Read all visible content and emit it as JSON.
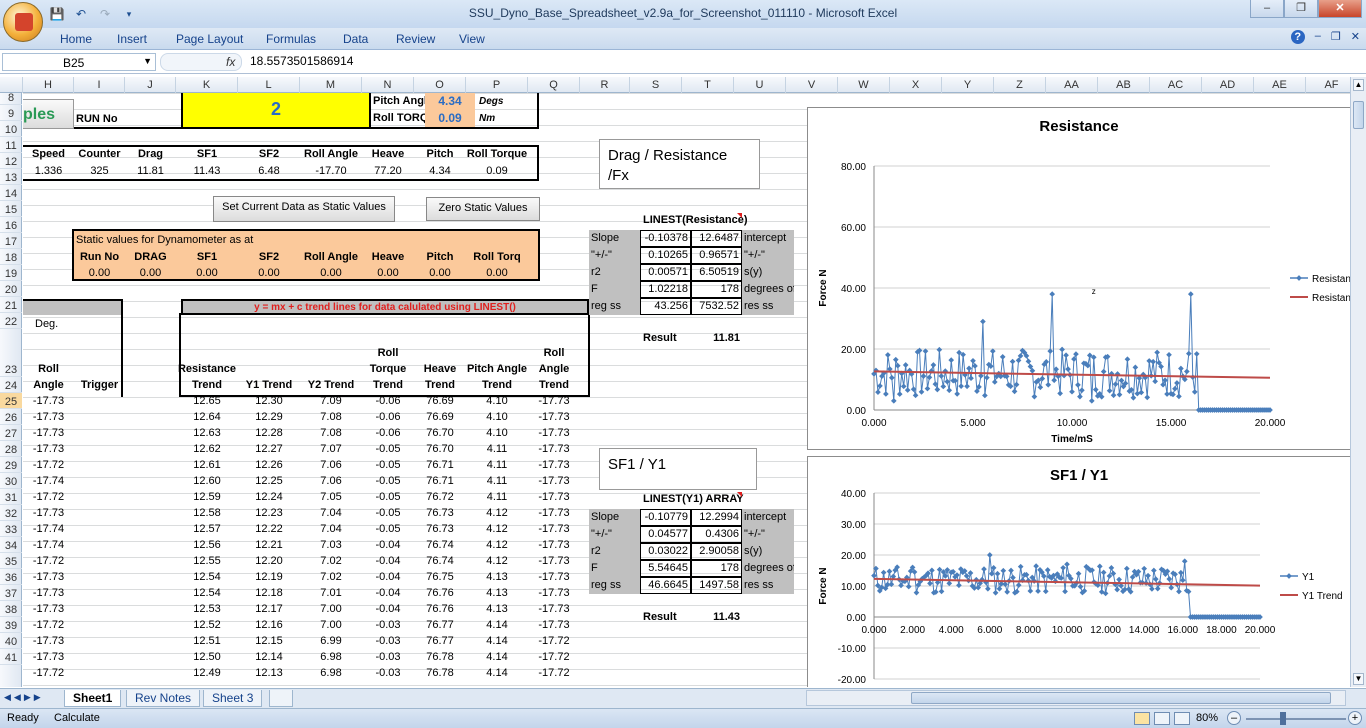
{
  "window": {
    "title": "SSU_Dyno_Base_Spreadsheet_v2.9a_for_Screenshot_011110 - Microsoft Excel"
  },
  "ribbon": {
    "tabs": [
      "Home",
      "Insert",
      "Page Layout",
      "Formulas",
      "Data",
      "Review",
      "View"
    ]
  },
  "formula_bar": {
    "name_box": "B25",
    "fx": "fx",
    "value": "18.5573501586914"
  },
  "columns": [
    "H",
    "I",
    "J",
    "K",
    "L",
    "M",
    "N",
    "O",
    "P",
    "Q",
    "R",
    "S",
    "T",
    "U",
    "V",
    "W",
    "X",
    "Y",
    "Z",
    "AA",
    "AB",
    "AC",
    "AD",
    "AE",
    "AF"
  ],
  "rows": [
    "8",
    "9",
    "10",
    "11",
    "12",
    "13",
    "14",
    "15",
    "16",
    "17",
    "18",
    "19",
    "20",
    "21",
    "22",
    "23",
    "24",
    "25",
    "26",
    "27",
    "28",
    "29",
    "30",
    "31",
    "32",
    "33",
    "34",
    "35",
    "36",
    "37",
    "38",
    "39",
    "40",
    "41"
  ],
  "header_block": {
    "ples": "ples",
    "run_no_label": "RUN No",
    "run_no_value": "2",
    "pitch_angle_label": "Pitch Angl",
    "pitch_angle_value": "4.34",
    "pitch_unit": "Degs",
    "roll_torque_label": "Roll TORQ",
    "roll_torque_value": "0.09",
    "roll_unit": "Nm"
  },
  "live_table": {
    "headers": [
      "Speed",
      "Counter",
      "Drag",
      "SF1",
      "SF2",
      "Roll Angle",
      "Heave",
      "Pitch",
      "Roll Torque"
    ],
    "values": [
      "1.336",
      "325",
      "11.81",
      "11.43",
      "6.48",
      "-17.70",
      "77.20",
      "4.34",
      "0.09"
    ]
  },
  "buttons": {
    "set_static": "Set Current Data as Static Values",
    "zero_static": "Zero Static Values"
  },
  "static_table": {
    "title": "Static values for Dynamometer as at",
    "headers": [
      "Run No",
      "DRAG",
      "SF1",
      "SF2",
      "Roll Angle",
      "Heave",
      "Pitch",
      "Roll Torq"
    ],
    "values": [
      "0.00",
      "0.00",
      "0.00",
      "0.00",
      "0.00",
      "0.00",
      "0.00",
      "0.00"
    ]
  },
  "trend_banner": "y = mx + c   trend lines for data calulated using LINEST()",
  "left_table": {
    "deg": "Deg.",
    "headers": [
      "Roll\nAngle",
      "Trigger"
    ],
    "values": [
      "-17.73",
      "-17.73",
      "-17.73",
      "-17.73",
      "-17.72",
      "-17.74",
      "-17.72",
      "-17.73",
      "-17.74",
      "-17.74",
      "-17.72",
      "-17.73",
      "-17.73",
      "-17.73",
      "-17.72",
      "-17.73",
      "-17.73",
      "-17.72"
    ]
  },
  "trend_table": {
    "headers": [
      "Resistance\nTrend",
      "Y1 Trend",
      "Y2 Trend",
      "Roll\nTorque\nTrend",
      "Heave\nTrend",
      "Pitch Angle\nTrend",
      "Roll\nAngle\nTrend"
    ],
    "rows": [
      [
        "12.65",
        "12.30",
        "7.09",
        "-0.06",
        "76.69",
        "4.10",
        "-17.73"
      ],
      [
        "12.64",
        "12.29",
        "7.08",
        "-0.06",
        "76.69",
        "4.10",
        "-17.73"
      ],
      [
        "12.63",
        "12.28",
        "7.08",
        "-0.06",
        "76.70",
        "4.10",
        "-17.73"
      ],
      [
        "12.62",
        "12.27",
        "7.07",
        "-0.05",
        "76.70",
        "4.11",
        "-17.73"
      ],
      [
        "12.61",
        "12.26",
        "7.06",
        "-0.05",
        "76.71",
        "4.11",
        "-17.73"
      ],
      [
        "12.60",
        "12.25",
        "7.06",
        "-0.05",
        "76.71",
        "4.11",
        "-17.73"
      ],
      [
        "12.59",
        "12.24",
        "7.05",
        "-0.05",
        "76.72",
        "4.11",
        "-17.73"
      ],
      [
        "12.58",
        "12.23",
        "7.04",
        "-0.05",
        "76.73",
        "4.12",
        "-17.73"
      ],
      [
        "12.57",
        "12.22",
        "7.04",
        "-0.05",
        "76.73",
        "4.12",
        "-17.73"
      ],
      [
        "12.56",
        "12.21",
        "7.03",
        "-0.04",
        "76.74",
        "4.12",
        "-17.73"
      ],
      [
        "12.55",
        "12.20",
        "7.02",
        "-0.04",
        "76.74",
        "4.12",
        "-17.73"
      ],
      [
        "12.54",
        "12.19",
        "7.02",
        "-0.04",
        "76.75",
        "4.13",
        "-17.73"
      ],
      [
        "12.54",
        "12.18",
        "7.01",
        "-0.04",
        "76.76",
        "4.13",
        "-17.73"
      ],
      [
        "12.53",
        "12.17",
        "7.00",
        "-0.04",
        "76.76",
        "4.13",
        "-17.73"
      ],
      [
        "12.52",
        "12.16",
        "7.00",
        "-0.03",
        "76.77",
        "4.14",
        "-17.73"
      ],
      [
        "12.51",
        "12.15",
        "6.99",
        "-0.03",
        "76.77",
        "4.14",
        "-17.72"
      ],
      [
        "12.50",
        "12.14",
        "6.98",
        "-0.03",
        "76.78",
        "4.14",
        "-17.72"
      ],
      [
        "12.49",
        "12.13",
        "6.98",
        "-0.03",
        "76.78",
        "4.14",
        "-17.72"
      ]
    ]
  },
  "drag_box": {
    "title": "Drag / Resistance\n/Fx"
  },
  "linest1": {
    "header": "LINEST(Resistance)",
    "rows": [
      [
        "Slope",
        "-0.10378",
        "12.6487",
        "intercept"
      ],
      [
        "\"+/-\"",
        "0.10265",
        "0.96571",
        "\"+/-\""
      ],
      [
        "r2",
        "0.00571",
        "6.50519",
        "s(y)"
      ],
      [
        "F",
        "1.02218",
        "178",
        "degrees of f"
      ],
      [
        "reg ss",
        "43.256",
        "7532.52",
        "res ss"
      ]
    ],
    "result_label": "Result",
    "result_value": "11.81"
  },
  "sf1_box": {
    "title": "SF1 / Y1"
  },
  "linest2": {
    "header": "LINEST(Y1) ARRAY",
    "rows": [
      [
        "Slope",
        "-0.10779",
        "12.2994",
        "intercept"
      ],
      [
        "\"+/-\"",
        "0.04577",
        "0.4306",
        "\"+/-\""
      ],
      [
        "r2",
        "0.03022",
        "2.90058",
        "s(y)"
      ],
      [
        "F",
        "5.54645",
        "178",
        "degrees of f"
      ],
      [
        "reg ss",
        "46.6645",
        "1497.58",
        "res ss"
      ]
    ],
    "result_label": "Result",
    "result_value": "11.43"
  },
  "chart_data": [
    {
      "type": "line",
      "title": "Resistance",
      "xlabel": "Time/mS",
      "ylabel": "Force N",
      "xlim": [
        0,
        20
      ],
      "ylim": [
        0,
        80
      ],
      "x_ticks": [
        "0.000",
        "5.000",
        "10.000",
        "15.000",
        "20.000"
      ],
      "y_ticks": [
        "0.00",
        "20.00",
        "40.00",
        "60.00",
        "80.00"
      ],
      "annotation": "z",
      "legend": "right",
      "series": [
        {
          "name": "Resistance",
          "color": "#4a7ebb"
        },
        {
          "name": "Resistance T",
          "color": "#be4b48",
          "line": [
            [
              0,
              12.65
            ],
            [
              20,
              10.57
            ]
          ]
        }
      ]
    },
    {
      "type": "line",
      "title": "SF1 / Y1",
      "xlabel": "Time/mS",
      "ylabel": "Force N",
      "xlim": [
        0,
        20
      ],
      "ylim": [
        -20,
        40
      ],
      "x_ticks": [
        "0.000",
        "2.000",
        "4.000",
        "6.000",
        "8.000",
        "10.000",
        "12.000",
        "14.000",
        "16.000",
        "18.000",
        "20.000"
      ],
      "y_ticks": [
        "-20.00",
        "-10.00",
        "0.00",
        "10.00",
        "20.00",
        "30.00",
        "40.00"
      ],
      "legend": "right",
      "series": [
        {
          "name": "Y1",
          "color": "#4a7ebb"
        },
        {
          "name": "Y1 Trend",
          "color": "#be4b48",
          "line": [
            [
              0,
              12.3
            ],
            [
              20,
              10.14
            ]
          ]
        }
      ]
    }
  ],
  "sheets": [
    "Sheet1",
    "Rev Notes",
    "Sheet 3"
  ],
  "status": {
    "ready": "Ready",
    "calculate": "Calculate",
    "zoom": "80%"
  }
}
